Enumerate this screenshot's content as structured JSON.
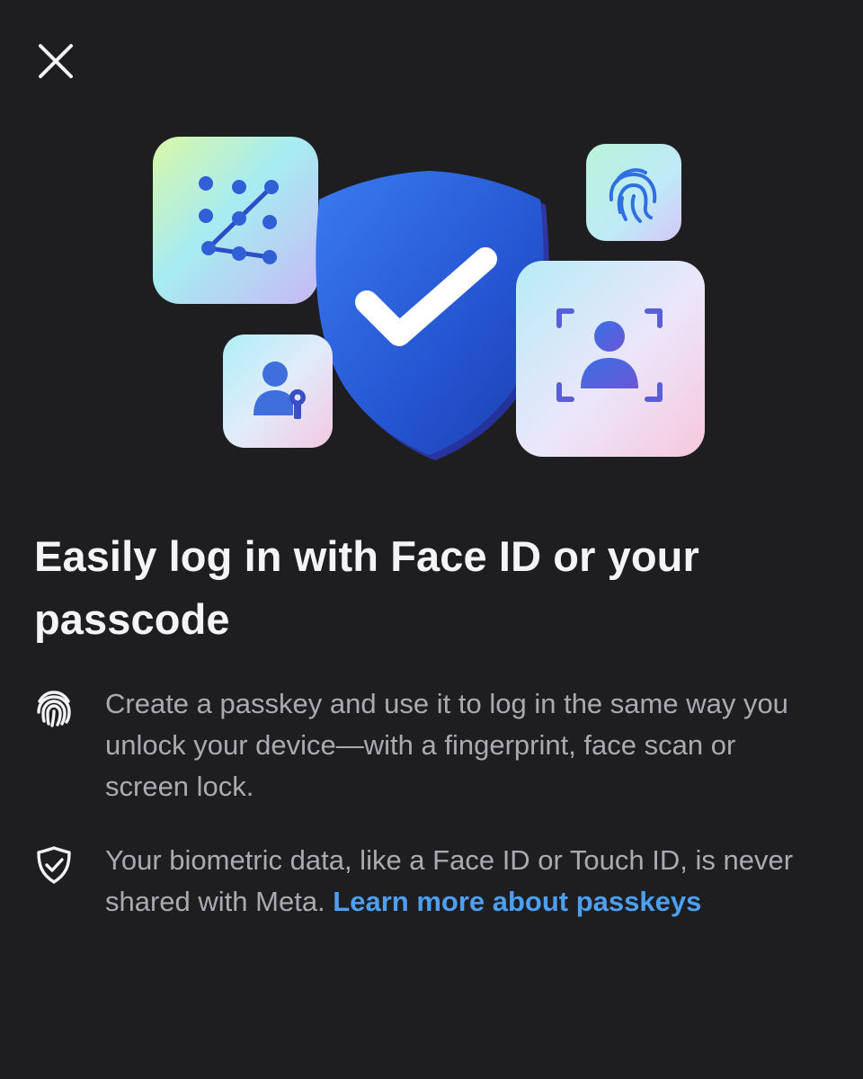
{
  "header": {
    "close_icon": "close-icon"
  },
  "hero": {
    "tiles": [
      "pattern-lock-icon",
      "shield-check-icon",
      "fingerprint-icon",
      "face-scan-icon",
      "user-key-icon"
    ]
  },
  "title": "Easily log in with Face ID or your passcode",
  "rows": [
    {
      "icon": "fingerprint-icon",
      "text": "Create a passkey and use it to log in the same way you unlock your device—with a fingerprint, face scan or screen lock."
    },
    {
      "icon": "shield-check-icon",
      "text": "Your biometric data, like a Face ID or Touch ID, is never shared with Meta. ",
      "link": "Learn more about passkeys"
    }
  ],
  "colors": {
    "background": "#1e1e20",
    "title": "#f4f4f6",
    "body_text": "#a9abb0",
    "link": "#4d9ff2",
    "shield_blue": "#2a5fd8"
  }
}
